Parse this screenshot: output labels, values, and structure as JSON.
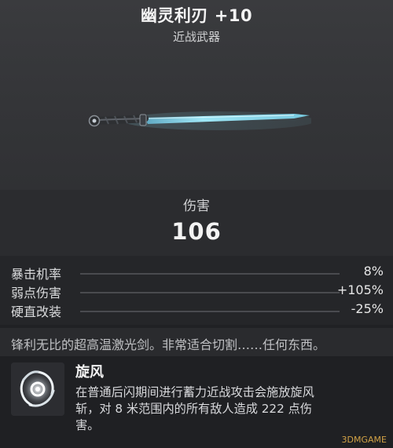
{
  "item": {
    "name": "幽灵利刃 +10",
    "type": "近战武器"
  },
  "icons": {
    "weapon": "energy-sword",
    "ability": "whirlwind-burst-icon"
  },
  "colors": {
    "blade": "#8fd8ea",
    "hilt": "#2c2e31",
    "accent": "#d7dde2"
  },
  "damage": {
    "label": "伤害",
    "value": "106"
  },
  "stats": [
    {
      "label": "暴击机率",
      "value": "8%"
    },
    {
      "label": "弱点伤害",
      "value": "+105%"
    },
    {
      "label": "硬直改装",
      "value": "-25%"
    }
  ],
  "description": "锋利无比的超高温激光剑。非常适合切割……任何东西。",
  "ability": {
    "title": "旋风",
    "lines": [
      "在普通后闪期间进行蓄力近战攻击会施放旋风",
      "斩，对 8 米范围内的所有敌人造成 222 点伤",
      "害。"
    ]
  },
  "watermark": "3DMGAME"
}
